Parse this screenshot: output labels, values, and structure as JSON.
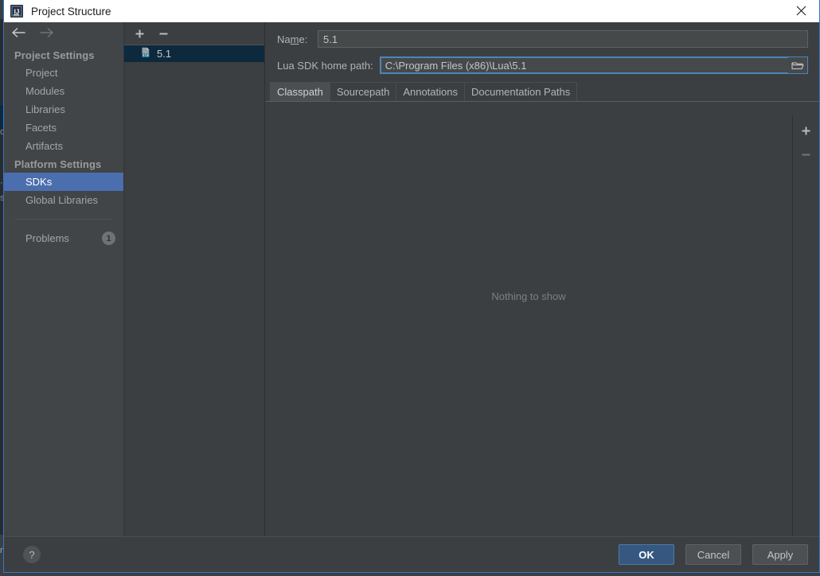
{
  "window": {
    "title": "Project Structure",
    "app_icon": "intellij-idea-icon",
    "close_icon": "close-icon"
  },
  "nav": {
    "back_icon": "arrow-left-icon",
    "forward_icon": "arrow-right-icon"
  },
  "sidebar": {
    "groups": [
      {
        "label": "Project Settings",
        "items": [
          {
            "label": "Project",
            "selected": false
          },
          {
            "label": "Modules",
            "selected": false
          },
          {
            "label": "Libraries",
            "selected": false
          },
          {
            "label": "Facets",
            "selected": false
          },
          {
            "label": "Artifacts",
            "selected": false
          }
        ]
      },
      {
        "label": "Platform Settings",
        "items": [
          {
            "label": "SDKs",
            "selected": true
          },
          {
            "label": "Global Libraries",
            "selected": false
          }
        ]
      }
    ],
    "problems": {
      "label": "Problems",
      "count": "1"
    }
  },
  "sdk_panel": {
    "add_icon": "plus-icon",
    "remove_icon": "minus-icon",
    "items": [
      {
        "label": "5.1",
        "icon": "lua-sdk-icon",
        "selected": true
      }
    ]
  },
  "form": {
    "name_label_before": "Na",
    "name_label_mnemonic": "m",
    "name_label_after": "e:",
    "name_value": "5.1",
    "path_label": "Lua SDK home path:",
    "path_value": "C:\\Program Files (x86)\\Lua\\5.1",
    "browse_icon": "folder-icon"
  },
  "tabs": [
    {
      "label": "Classpath",
      "active": true
    },
    {
      "label": "Sourcepath",
      "active": false
    },
    {
      "label": "Annotations",
      "active": false
    },
    {
      "label": "Documentation Paths",
      "active": false
    }
  ],
  "table": {
    "empty_text": "Nothing to show",
    "add_icon": "plus-icon",
    "remove_icon": "minus-icon"
  },
  "footer": {
    "help_label": "?",
    "buttons": [
      {
        "label": "OK",
        "style": "primary"
      },
      {
        "label": "Cancel",
        "style": "normal"
      },
      {
        "label": "Apply",
        "style": "normal"
      }
    ]
  },
  "colors": {
    "accent": "#4b6eaf",
    "primary_button": "#365880",
    "selection_list": "#0d293e",
    "focus_border": "#4f84b8",
    "dialog_bg": "#3c3f41",
    "sidebar_bg": "#414548"
  }
}
